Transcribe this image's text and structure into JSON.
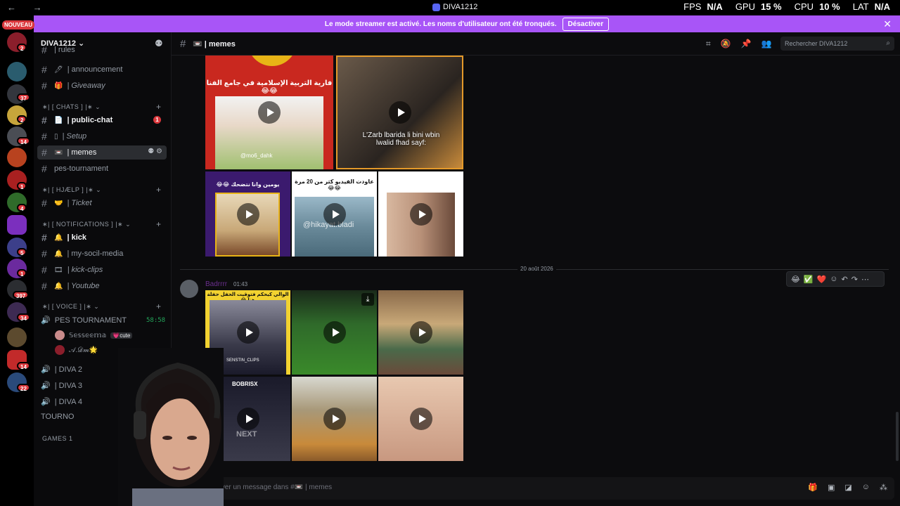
{
  "window": {
    "title": "DIVA1212",
    "nav": "← →"
  },
  "stats": {
    "fps_label": "FPS",
    "fps": "N/A",
    "gpu_label": "GPU",
    "gpu": "15 %",
    "cpu_label": "CPU",
    "cpu": "10 %",
    "lat_label": "LAT",
    "lat": "N/A"
  },
  "banner": {
    "text": "Le mode streamer est activé. Les noms d'utilisateur ont été tronqués.",
    "button": "Désactiver",
    "close": "✕"
  },
  "guilds": {
    "new_label": "NOUVEAU",
    "badges": [
      "2",
      "37",
      "2",
      "14",
      "1",
      "4",
      "5",
      "1",
      "397",
      "34",
      "14",
      "22"
    ]
  },
  "server": {
    "name": "DIVA1212 ⌄"
  },
  "channels": {
    "partial_top": "| rules",
    "announcement": "| announcement",
    "giveaway": "| Giveaway",
    "cat_chats": "∗| [ CHATS ] |∗ ⌄",
    "public_chat": "| public-chat",
    "public_chat_badge": "1",
    "setup": "| Setup",
    "memes": "| memes",
    "pes_tournament": "pes-tournament",
    "cat_help": "∗| [ HJÆLP ] |∗ ⌄",
    "ticket": "| Ticket",
    "cat_notifications": "∗| [ NOTIFICATIONS ] |∗ ⌄",
    "kick": "| kick",
    "social": "| my-socil-media",
    "kick_clips": "| kick-clips",
    "youtube": "| Youtube",
    "cat_voice": "∗| [ VOICE ] |∗ ⌄"
  },
  "voice": {
    "pes_tournament": "PES TOURNAMENT",
    "timer": "58:58",
    "user1": "𝕊𝕖𝕤𝕤𝕖𝕖𝕞𝕒",
    "user1_tag": "💗cute",
    "user2": "𝒜.𝒟𝓂🌟",
    "diva2": "| DIVA 2",
    "diva3": "| DIVA 3",
    "diva4": "| DIVA 4",
    "tourno": "TOURNO",
    "games": "GAMES 1"
  },
  "header": {
    "channel": "| memes",
    "search_placeholder": "Rechercher DIVA1212"
  },
  "message_feed": {
    "captions": {
      "top_left": "فارية التربية الإسلامية في جامع الفنا 😂😂",
      "top_left_handle": "@mo6_dahk",
      "top_right": "L'Zarb lbarida li bini wbin lwalid fhad sayf:",
      "mid_left": "يومين وانا نتضحك 😂😂",
      "mid_center": "عاودت الفيديو كثر من 20 مرة 😂😂",
      "mid_center_handle": "@hikayat.bladi",
      "mid_right": "😂😂"
    },
    "date_divider": "20 août 2026",
    "author": "Badrrrr",
    "time": "01:43",
    "post_captions": {
      "left": "الوالي كيحكم فتوقيت الحفل حفلة هنا 😂",
      "handle": "SENSTIN_CLIPS",
      "bottom_left": "BOBRISX",
      "bottom_left_small": "NEXT"
    }
  },
  "reactions": [
    "😂",
    "✅",
    "❤️",
    "☺",
    "↶",
    "↷",
    "⋯"
  ],
  "composer": {
    "placeholder": "Envoyer un message dans #📼 | memes",
    "plus": "+"
  },
  "colors": {
    "banner": "#a855f7",
    "accent": "#5865f2",
    "badge": "#da373c",
    "online": "#23a55a"
  }
}
